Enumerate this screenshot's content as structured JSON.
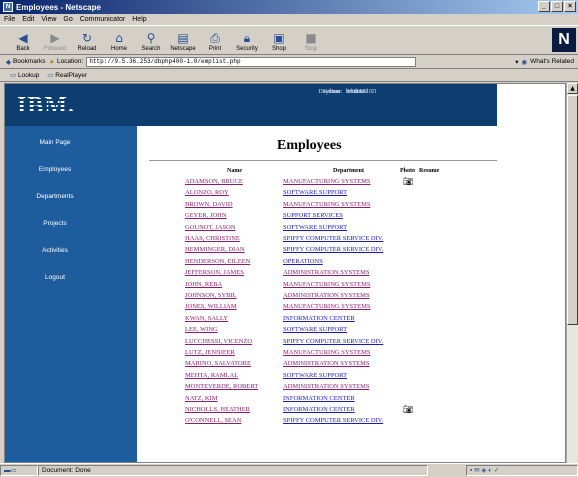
{
  "window": {
    "title": "Employees - Netscape"
  },
  "menu": [
    "File",
    "Edit",
    "View",
    "Go",
    "Communicator",
    "Help"
  ],
  "toolbar": [
    {
      "label": "Back",
      "icon": "back-arrow-icon",
      "enabled": true
    },
    {
      "label": "Forward",
      "icon": "forward-arrow-icon",
      "enabled": false
    },
    {
      "label": "Reload",
      "icon": "reload-icon",
      "enabled": true
    },
    {
      "label": "Home",
      "icon": "home-icon",
      "enabled": true
    },
    {
      "label": "Search",
      "icon": "search-icon",
      "enabled": true
    },
    {
      "label": "Netscape",
      "icon": "netscape-icon",
      "enabled": true
    },
    {
      "label": "Print",
      "icon": "print-icon",
      "enabled": true
    },
    {
      "label": "Security",
      "icon": "lock-icon",
      "enabled": true
    },
    {
      "label": "Shop",
      "icon": "shop-icon",
      "enabled": true
    },
    {
      "label": "Stop",
      "icon": "stop-icon",
      "enabled": false
    }
  ],
  "location": {
    "bookmarks_label": "Bookmarks",
    "location_label": "Location:",
    "url": "http://9.5.36.253/dbphp400-1.0/emplist.php",
    "related_label": "What's Related"
  },
  "personal_toolbar": [
    "Lookup",
    "RealPlayer"
  ],
  "banner": {
    "logo": "IBM.",
    "system_label": "System:",
    "system_value": "rchas10d",
    "database_label": "Database:",
    "database_value": "RCHAS10D",
    "user_label": "User:",
    "user_value": "brxdms"
  },
  "nav": [
    "Main Page",
    "Employees",
    "Departments",
    "Projects",
    "Activities",
    "Logout"
  ],
  "page": {
    "title": "Employees",
    "headers": {
      "name": "Name",
      "department": "Department",
      "photo": "Photo",
      "resume": "Resume"
    }
  },
  "employees": [
    {
      "name": "ADAMSON, BRUCE",
      "department": "MANUFACTURING SYSTEMS",
      "photo": true
    },
    {
      "name": "ALONZO, ROY",
      "department": "SOFTWARE SUPPORT",
      "photo": false
    },
    {
      "name": "BROWN, DAVID",
      "department": "MANUFACTURING SYSTEMS",
      "photo": false
    },
    {
      "name": "GEYER, JOHN",
      "department": "SUPPORT SERVICES",
      "photo": false
    },
    {
      "name": "GOUNOT, JASON",
      "department": "SOFTWARE SUPPORT",
      "photo": false
    },
    {
      "name": "HAAS, CHRISTINE",
      "department": "SPIFFY COMPUTER SERVICE DIV.",
      "photo": false
    },
    {
      "name": "HEMMINGER, DIAN",
      "department": "SPIFFY COMPUTER SERVICE DIV.",
      "photo": false
    },
    {
      "name": "HENDERSON, EILEEN",
      "department": "OPERATIONS",
      "photo": false
    },
    {
      "name": "JEFFERSON, JAMES",
      "department": "ADMINISTRATION SYSTEMS",
      "photo": false
    },
    {
      "name": "JOHN, REBA",
      "department": "MANUFACTURING SYSTEMS",
      "photo": false
    },
    {
      "name": "JOHNSON, SYBIL",
      "department": "ADMINISTRATION SYSTEMS",
      "photo": false
    },
    {
      "name": "JONES, WILLIAM",
      "department": "MANUFACTURING SYSTEMS",
      "photo": false
    },
    {
      "name": "KWAN, SALLY",
      "department": "INFORMATION CENTER",
      "photo": false
    },
    {
      "name": "LEE, WING",
      "department": "SOFTWARE SUPPORT",
      "photo": false
    },
    {
      "name": "LUCCHESSI, VICENZO",
      "department": "SPIFFY COMPUTER SERVICE DIV.",
      "photo": false
    },
    {
      "name": "LUTZ, JENNIFER",
      "department": "MANUFACTURING SYSTEMS",
      "photo": false
    },
    {
      "name": "MARINO, SALVATORE",
      "department": "ADMINISTRATION SYSTEMS",
      "photo": false
    },
    {
      "name": "MEHTA, RAMLAL",
      "department": "SOFTWARE SUPPORT",
      "photo": false
    },
    {
      "name": "MONTEVERDE, ROBERT",
      "department": "ADMINISTRATION SYSTEMS",
      "photo": false
    },
    {
      "name": "NATZ, KIM",
      "department": "INFORMATION CENTER",
      "photo": false
    },
    {
      "name": "NICHOLLS, HEATHER",
      "department": "INFORMATION CENTER",
      "photo": true
    },
    {
      "name": "O'CONNELL, SEAN",
      "department": "SPIFFY COMPUTER SERVICE DIV.",
      "photo": false
    }
  ],
  "status": {
    "text": "Document: Done"
  },
  "colors": {
    "banner": "#0e3e6f",
    "sidebar": "#1d5d9e",
    "visited_link": "#8a1e6e",
    "link": "#1a1ab4"
  }
}
